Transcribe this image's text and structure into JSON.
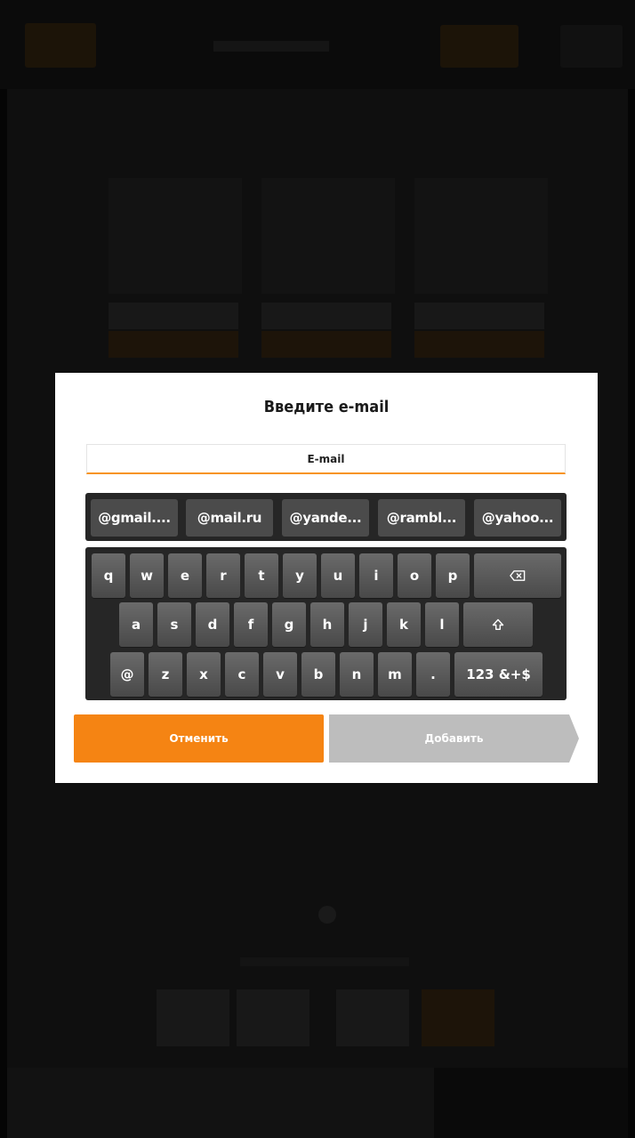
{
  "dialog": {
    "title": "Введите e-mail",
    "email_placeholder": "E-mail"
  },
  "suggestions": [
    "@gmail....",
    "@mail.ru",
    "@yande...",
    "@rambl...",
    "@yahoo..."
  ],
  "keyboard": {
    "row1": [
      "q",
      "w",
      "e",
      "r",
      "t",
      "y",
      "u",
      "i",
      "o",
      "p"
    ],
    "row2": [
      "a",
      "s",
      "d",
      "f",
      "g",
      "h",
      "j",
      "k",
      "l"
    ],
    "row3": [
      "@",
      "z",
      "x",
      "c",
      "v",
      "b",
      "n",
      "m",
      "."
    ],
    "backspace_icon": "backspace-icon",
    "shift_icon": "shift-icon",
    "mode_switch_label": "123 &+$"
  },
  "buttons": {
    "cancel_label": "Отменить",
    "add_label": "Добавить"
  },
  "colors": {
    "accent": "#f58413",
    "disabled": "#bdbdbd",
    "keyboard_bg": "#262626",
    "key_bg": "#5a5a5a"
  }
}
